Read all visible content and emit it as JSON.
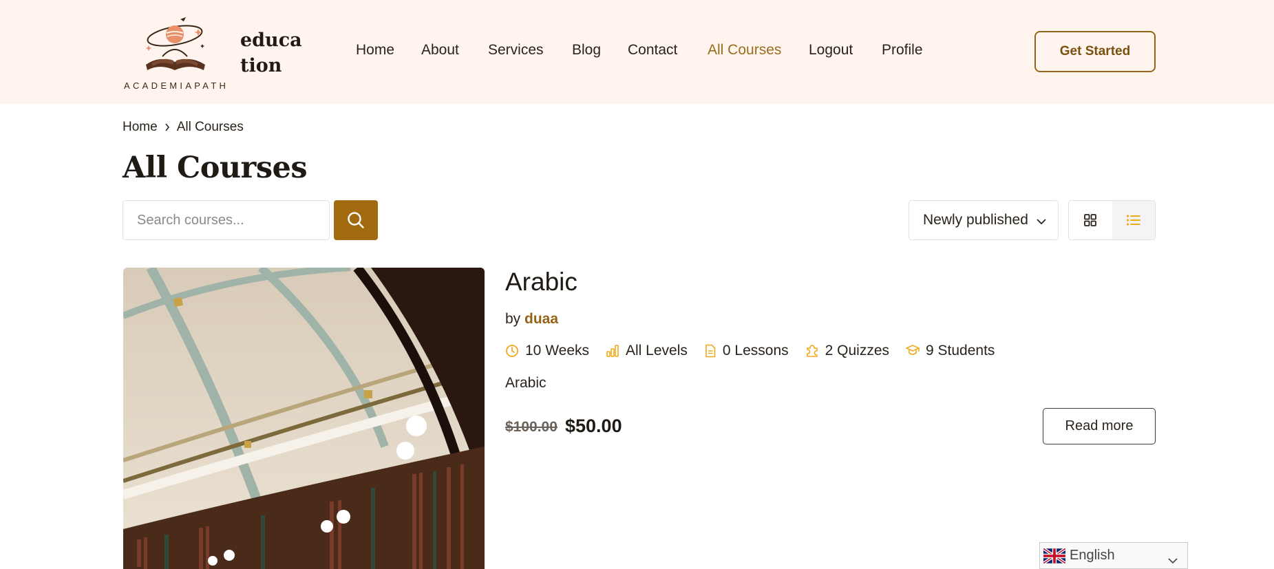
{
  "logo": {
    "wordmark": "ACADEMIAPATH",
    "site_name_line1": "educa",
    "site_name_line2": "tion"
  },
  "nav": {
    "items": [
      {
        "label": "Home"
      },
      {
        "label": "About"
      },
      {
        "label": "Services"
      },
      {
        "label": "Blog"
      },
      {
        "label": "Contact"
      },
      {
        "label": "All Courses",
        "active": true
      },
      {
        "label": "Logout"
      },
      {
        "label": "Profile"
      }
    ],
    "cta_label": "Get Started"
  },
  "breadcrumb": {
    "home": "Home",
    "current": "All Courses"
  },
  "page_title": "All Courses",
  "search": {
    "placeholder": "Search courses...",
    "value": ""
  },
  "sort": {
    "selected": "Newly published"
  },
  "view": {
    "active": "list"
  },
  "course": {
    "title": "Arabic",
    "by_label": "by",
    "author": "duaa",
    "meta": {
      "duration": "10 Weeks",
      "level": "All Levels",
      "lessons": "0 Lessons",
      "quizzes": "2 Quizzes",
      "students": "9 Students"
    },
    "description": "Arabic",
    "price_old": "$100.00",
    "price_new": "$50.00",
    "read_more_label": "Read more"
  },
  "language": {
    "selected": "English"
  },
  "colors": {
    "accent": "#946318",
    "header_bg": "#fff5ee",
    "meta_icon": "#f0a91a",
    "search_button": "#a36b10"
  },
  "icons": {
    "search": "search-icon",
    "grid_view": "grid-icon",
    "list_view": "list-icon",
    "duration": "clock-icon",
    "level": "bar-chart-icon",
    "lessons": "document-icon",
    "quizzes": "puzzle-icon",
    "students": "graduation-cap-icon"
  }
}
